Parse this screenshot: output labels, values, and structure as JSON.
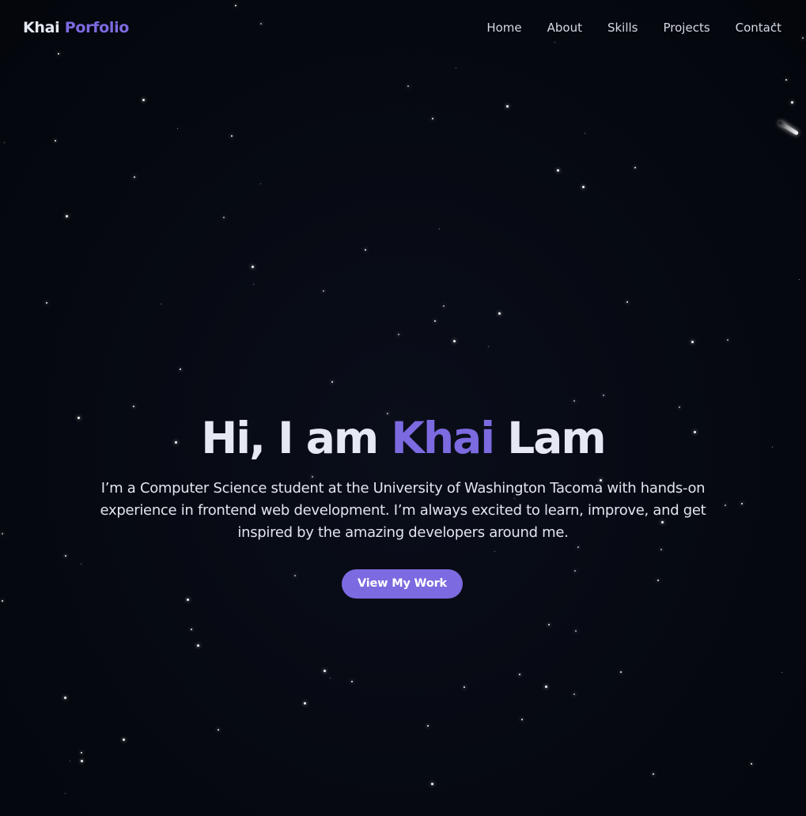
{
  "navbar": {
    "brand_first": "Khai",
    "brand_second": "Porfolio",
    "links": [
      "Home",
      "About",
      "Skills",
      "Projects",
      "Contact"
    ]
  },
  "hero": {
    "title_prefix": "Hi, I am",
    "title_highlight": "Khai",
    "title_suffix": "Lam",
    "description": "I’m a Computer Science student at the University of Washington Tacoma with hands-on experience in frontend web development. I’m always excited to learn, improve, and get inspired by the amazing developers around me.",
    "cta_label": "View My Work"
  },
  "colors": {
    "background": "#060912",
    "accent": "#7c6ae0",
    "text_primary": "#e6e9f4",
    "star": "#ffffff"
  }
}
